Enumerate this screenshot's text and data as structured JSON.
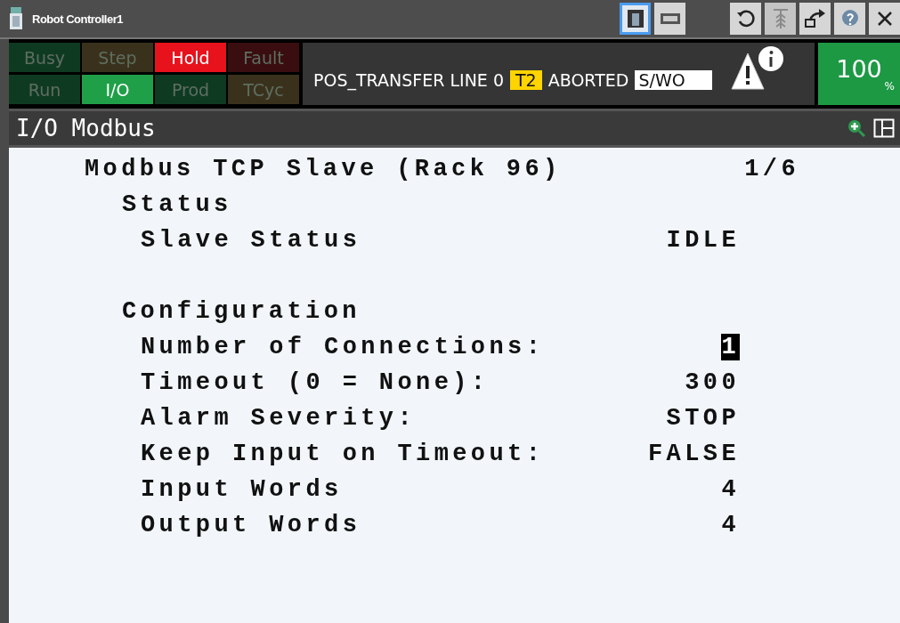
{
  "window": {
    "title": "Robot Controller1"
  },
  "lamps": [
    {
      "label": "Busy",
      "on": false,
      "kind": "run"
    },
    {
      "label": "Step",
      "on": false,
      "kind": "wait"
    },
    {
      "label": "Hold",
      "on": true,
      "kind": "alarm"
    },
    {
      "label": "Fault",
      "on": false,
      "kind": "fault"
    },
    {
      "label": "Run",
      "on": false,
      "kind": "run"
    },
    {
      "label": "I/O",
      "on": true,
      "kind": "run"
    },
    {
      "label": "Prod",
      "on": false,
      "kind": "run"
    },
    {
      "label": "TCyc",
      "on": false,
      "kind": "wait"
    }
  ],
  "message": {
    "program": "POS_TRANSFER LINE 0",
    "mode": "T2",
    "state": "ABORTED",
    "note": "S/WO"
  },
  "override": {
    "value": "100",
    "unit": "%"
  },
  "screen": {
    "title": "I/O Modbus"
  },
  "lines": [
    {
      "kind": "heading",
      "label": "Modbus TCP Slave (Rack 96)",
      "value": "1/6"
    },
    {
      "kind": "section",
      "label": "Status"
    },
    {
      "kind": "field",
      "label": "Slave Status",
      "value": "IDLE",
      "selected": false
    },
    {
      "kind": "section",
      "label": "Configuration"
    },
    {
      "kind": "field",
      "label": "Number of Connections:",
      "value": "1",
      "selected": true
    },
    {
      "kind": "field",
      "label": "Timeout (0 = None):",
      "value": "300",
      "selected": false
    },
    {
      "kind": "field",
      "label": "Alarm Severity:",
      "value": "STOP",
      "selected": false
    },
    {
      "kind": "field",
      "label": "Keep Input on Timeout:",
      "value": "FALSE",
      "selected": false
    },
    {
      "kind": "field",
      "label": "Input Words",
      "value": "4",
      "selected": false
    },
    {
      "kind": "field",
      "label": "Output Words",
      "value": "4",
      "selected": false
    }
  ]
}
